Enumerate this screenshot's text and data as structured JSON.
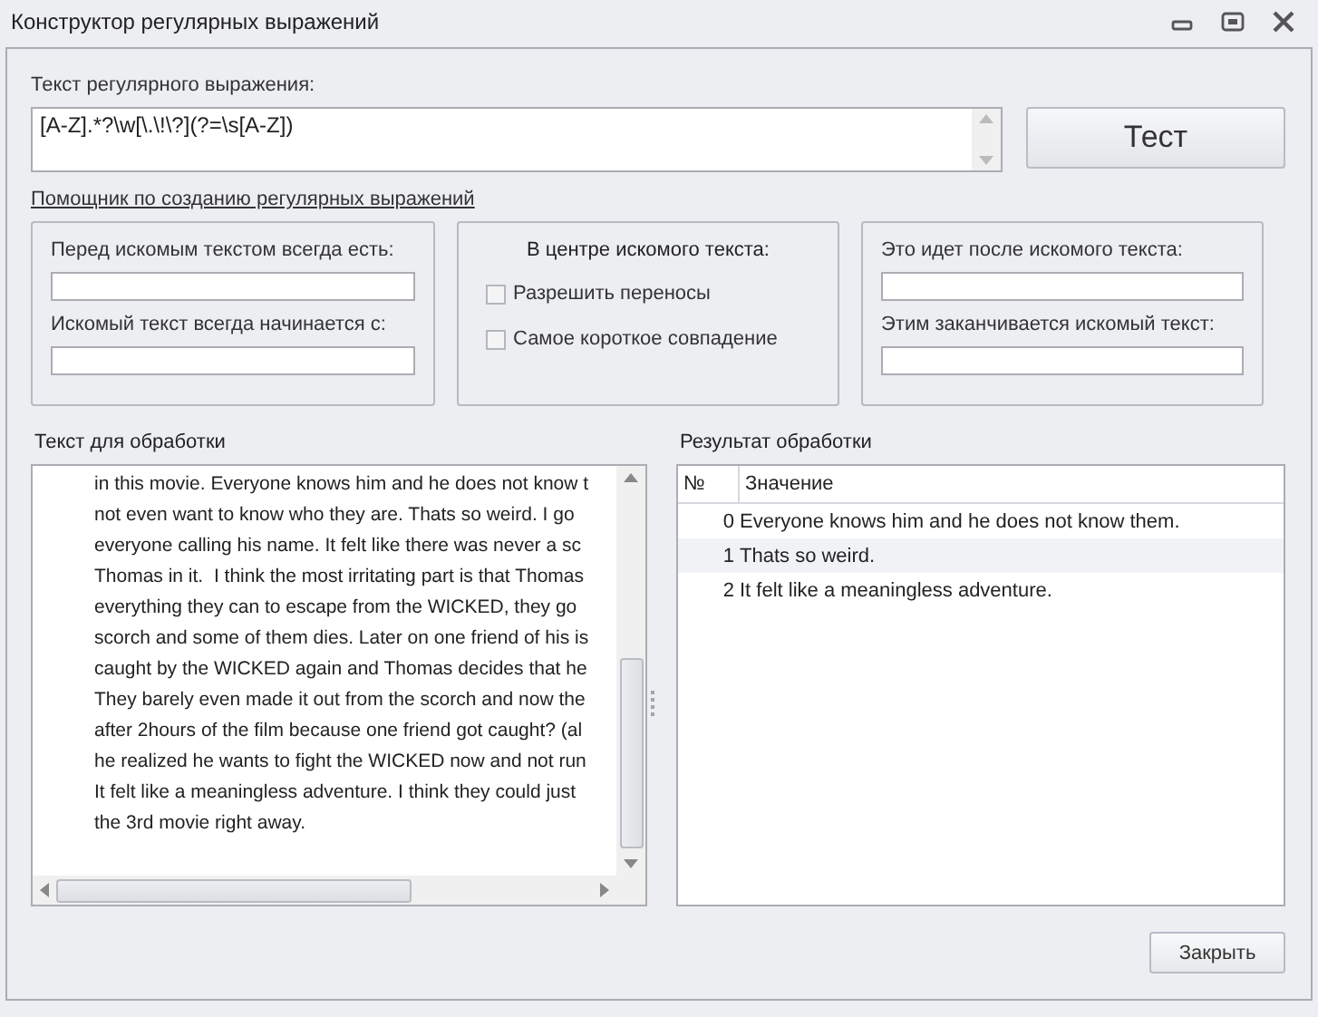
{
  "window": {
    "title": "Конструктор регулярных выражений"
  },
  "regex": {
    "label": "Текст регулярного выражения:",
    "value": "[A-Z].*?\\w[\\.\\!\\?](?=\\s[A-Z])"
  },
  "test_button": "Тест",
  "helper_link": "Помощник по созданию регулярных выражений",
  "before_group": {
    "fields": [
      {
        "label": "Перед искомым текстом всегда есть:"
      },
      {
        "label": "Искомый текст всегда начинается с:"
      }
    ]
  },
  "center_group": {
    "title": "В центре искомого текста:",
    "options": [
      {
        "label": "Разрешить переносы",
        "checked": false
      },
      {
        "label": "Самое короткое совпадение",
        "checked": false
      }
    ]
  },
  "after_group": {
    "fields": [
      {
        "label": "Это идет после искомого текста:"
      },
      {
        "label": "Этим заканчивается искомый текст:"
      }
    ]
  },
  "input_panel": {
    "title": "Текст для обработки",
    "lines": [
      "in this movie. Everyone knows him and he does not know t",
      "not even want to know who they are. Thats so weird. I go",
      "everyone calling his name. It felt like there was never a sc",
      "Thomas in it.  I think the most irritating part is that Thomas",
      "everything they can to escape from the WICKED, they go",
      "scorch and some of them dies. Later on one friend of his is",
      "caught by the WICKED again and Thomas decides that he",
      "They barely even made it out from the scorch and now the",
      "after 2hours of the film because one friend got caught? (al",
      "he realized he wants to fight the WICKED now and not run",
      "It felt like a meaningless adventure. I think they could just",
      "the 3rd movie right away."
    ]
  },
  "result_panel": {
    "title": "Результат обработки",
    "columns": [
      "№",
      "Значение"
    ],
    "rows": [
      {
        "index": "0",
        "value": "Everyone knows him and he does not know them."
      },
      {
        "index": "1",
        "value": "Thats so weird."
      },
      {
        "index": "2",
        "value": "It felt like a meaningless adventure."
      }
    ]
  },
  "close_button": "Закрыть"
}
